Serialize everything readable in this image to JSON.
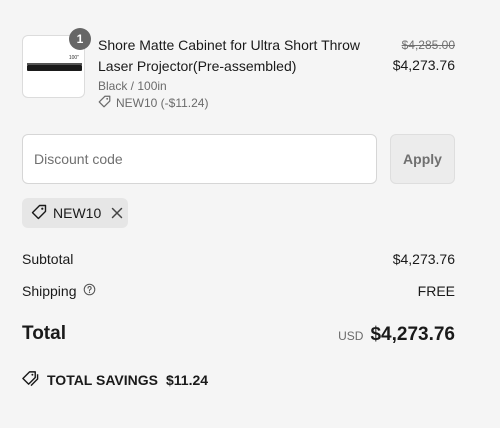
{
  "cart_item": {
    "quantity": "1",
    "thumbnail_label": "100\"",
    "title": "Shore Matte Cabinet for Ultra Short Throw Laser Projector(Pre-assembled)",
    "variant": "Black / 100in",
    "discount_applied": "NEW10 (-$11.24)",
    "original_price": "$4,285.00",
    "price": "$4,273.76"
  },
  "discount": {
    "placeholder": "Discount code",
    "apply_label": "Apply",
    "chip_code": "NEW10"
  },
  "summary": {
    "subtotal_label": "Subtotal",
    "subtotal_value": "$4,273.76",
    "shipping_label": "Shipping",
    "shipping_value": "FREE",
    "total_label": "Total",
    "total_currency": "USD",
    "total_value": "$4,273.76",
    "savings_label": "TOTAL SAVINGS",
    "savings_value": "$11.24"
  },
  "colors": {
    "background": "#f5f5f5",
    "qty_badge": "#666666",
    "muted_text": "#6b6b6b",
    "chip_bg": "#e6e6e6"
  },
  "icons": [
    "tag-icon",
    "close-icon",
    "help-circle-icon",
    "tags-icon"
  ]
}
